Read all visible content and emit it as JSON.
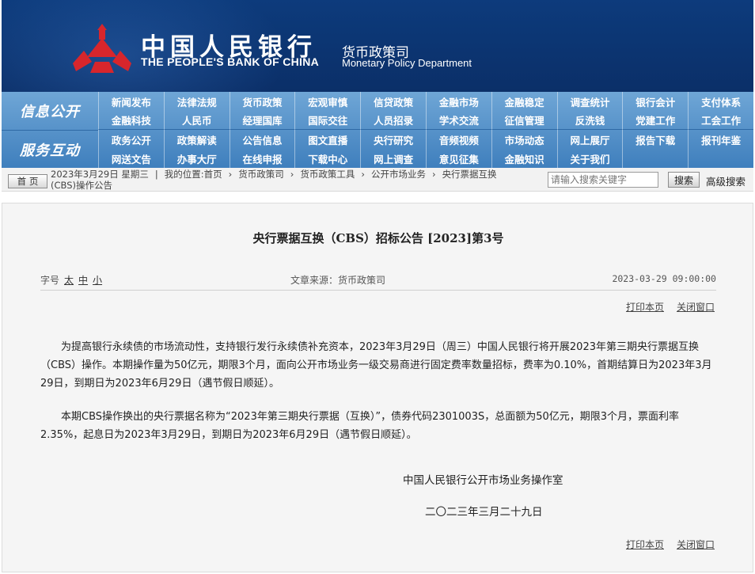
{
  "header": {
    "org_cn": "中国人民银行",
    "org_en": "THE PEOPLE'S BANK OF CHINA",
    "dept_cn": "货币政策司",
    "dept_en": "Monetary Policy Department"
  },
  "nav": {
    "section1_title": "信息公开",
    "section2_title": "服务互动",
    "items": [
      "新闻发布",
      "法律法规",
      "货币政策",
      "宏观审慎",
      "信贷政策",
      "金融市场",
      "金融稳定",
      "调查统计",
      "银行会计",
      "支付体系",
      "金融科技",
      "人民币",
      "经理国库",
      "国际交往",
      "人员招录",
      "学术交流",
      "征信管理",
      "反洗钱",
      "党建工作",
      "工会工作",
      "政务公开",
      "政策解读",
      "公告信息",
      "图文直播",
      "央行研究",
      "音频视频",
      "市场动态",
      "网上展厅",
      "报告下载",
      "报刊年鉴",
      "网送文告",
      "办事大厅",
      "在线申报",
      "下载中心",
      "网上调查",
      "意见征集",
      "金融知识",
      "关于我们",
      "",
      ""
    ]
  },
  "crumbbar": {
    "home_label": "首 页",
    "date": "2023年3月29日 星期三",
    "location_prefix": "我的位置:首页",
    "path": [
      "货币政策司",
      "货币政策工具",
      "公开市场业务",
      "央行票据互换"
    ],
    "current": "(CBS)操作公告",
    "search_placeholder": "请输入搜索关键字",
    "search_button": "搜索",
    "advanced_search": "高级搜索"
  },
  "article": {
    "title": "央行票据互换（CBS）招标公告 [2023]第3号",
    "font_size_label": "字号",
    "font_sizes": [
      "太",
      "中",
      "小"
    ],
    "source": "文章来源：货币政策司",
    "datetime": "2023-03-29 09:00:00",
    "print_label": "打印本页",
    "close_label": "关闭窗口",
    "paragraphs": [
      "为提高银行永续债的市场流动性，支持银行发行永续债补充资本，2023年3月29日（周三）中国人民银行将开展2023年第三期央行票据互换（CBS）操作。本期操作量为50亿元，期限3个月，面向公开市场业务一级交易商进行固定费率数量招标，费率为0.10%，首期结算日为2023年3月29日，到期日为2023年6月29日（遇节假日顺延）。",
      "本期CBS操作换出的央行票据名称为“2023年第三期央行票据（互换）”，债券代码2301003S，总面额为50亿元，期限3个月，票面利率2.35%，起息日为2023年3月29日，到期日为2023年6月29日（遇节假日顺延）。"
    ],
    "signature_org": "中国人民银行公开市场业务操作室",
    "signature_date": "二〇二三年三月二十九日"
  },
  "colors": {
    "banner": "#0b2f68",
    "nav": "#4f8cc6",
    "logo_red": "#d7262c"
  }
}
